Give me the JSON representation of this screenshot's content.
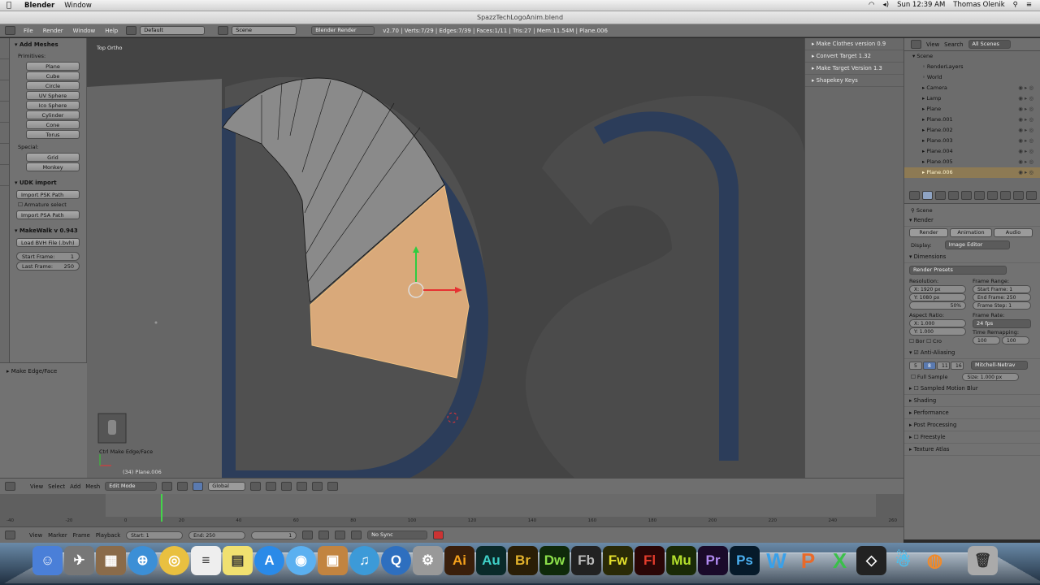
{
  "menubar": {
    "app": "Blender",
    "menu_window": "Window",
    "time": "Sun 12:39 AM",
    "user": "Thomas Olenik"
  },
  "window_title": "SpazzTechLogoAnim.blend",
  "infobar": {
    "menus": [
      "File",
      "Render",
      "Window",
      "Help"
    ],
    "layout": "Default",
    "scene": "Scene",
    "engine": "Blender Render",
    "stats": "v2.70 | Verts:7/29 | Edges:7/39 | Faces:1/11 | Tris:27 | Mem:11.54M | Plane.006"
  },
  "toolshelf": {
    "add_meshes": "Add Meshes",
    "primitives_label": "Primitives:",
    "primitives": [
      "Plane",
      "Cube",
      "Circle",
      "UV Sphere",
      "Ico Sphere",
      "Cylinder",
      "Cone",
      "Torus"
    ],
    "special_label": "Special:",
    "special": [
      "Grid",
      "Monkey"
    ],
    "udk_import": "UDK import",
    "import_psk": "Import PSK Path",
    "armature_select": "Armature select",
    "import_psa": "Import PSA Path",
    "makewalk": "MakeWalk v 0.943",
    "load_bvh": "Load BVH File (.bvh)",
    "start_frame_label": "Start Frame:",
    "start_frame_value": "1",
    "last_frame_label": "Last Frame:",
    "last_frame_value": "250"
  },
  "lower_panel": {
    "title": "Make Edge/Face"
  },
  "viewport": {
    "view_label": "Top Ortho",
    "operator": "Ctrl Make Edge/Face",
    "object_info": "(34) Plane.006"
  },
  "mid_panel": [
    "Make Clothes version 0.9",
    "Convert Target 1.32",
    "Make Target Version 1.3",
    "Shapekey Keys"
  ],
  "outliner": {
    "tabs": [
      "View",
      "Search",
      "All Scenes"
    ],
    "items": [
      "Scene",
      "RenderLayers",
      "World",
      "Camera",
      "Lamp",
      "Plane",
      "Plane.001",
      "Plane.002",
      "Plane.003",
      "Plane.004",
      "Plane.005",
      "Plane.006"
    ]
  },
  "props": {
    "scene_label": "Scene",
    "render_section": "Render",
    "render_buttons": [
      "Render",
      "Animation",
      "Audio"
    ],
    "display_label": "Display:",
    "display_value": "Image Editor",
    "dimensions": "Dimensions",
    "render_presets": "Render Presets",
    "resolution_label": "Resolution:",
    "res_x": "X: 1920 px",
    "res_y": "Y: 1080 px",
    "res_pct": "50%",
    "frame_range_label": "Frame Range:",
    "start_frame": "Start Frame: 1",
    "end_frame": "End Frame: 250",
    "frame_step": "Frame Step: 1",
    "aspect_label": "Aspect Ratio:",
    "aspect_x": "X: 1.000",
    "aspect_y": "Y: 1.000",
    "frame_rate_label": "Frame Rate:",
    "frame_rate": "24 fps",
    "time_remap_label": "Time Remapping:",
    "remap_old": "100",
    "remap_new": "100",
    "border": "Bor",
    "crop": "Cro",
    "anti_aliasing": "Anti-Aliasing",
    "aa_samples": [
      "5",
      "8",
      "11",
      "16"
    ],
    "aa_filter": "Mitchell-Netrav",
    "full_sample": "Full Sample",
    "filter_size": "Size: 1.000 px",
    "sections": [
      "Sampled Motion Blur",
      "Shading",
      "Performance",
      "Post Processing",
      "Freestyle",
      "Texture Atlas"
    ]
  },
  "vp_header": {
    "menus": [
      "View",
      "Select",
      "Add",
      "Mesh"
    ],
    "mode": "Edit Mode",
    "pivot": "Global"
  },
  "timeline": {
    "ticks": [
      "-40",
      "-20",
      "0",
      "20",
      "40",
      "60",
      "80",
      "100",
      "120",
      "140",
      "160",
      "180",
      "200",
      "220",
      "240",
      "260"
    ]
  },
  "tl_header": {
    "menus": [
      "View",
      "Marker",
      "Frame",
      "Playback"
    ],
    "start": "Start: 1",
    "end": "End: 250",
    "current": "1",
    "sync": "No Sync"
  },
  "colors": {
    "accent": "#e8a86a",
    "face_select": "#d9a97a",
    "viewport_bg": "#444444",
    "letters": "#2c3d5a"
  }
}
